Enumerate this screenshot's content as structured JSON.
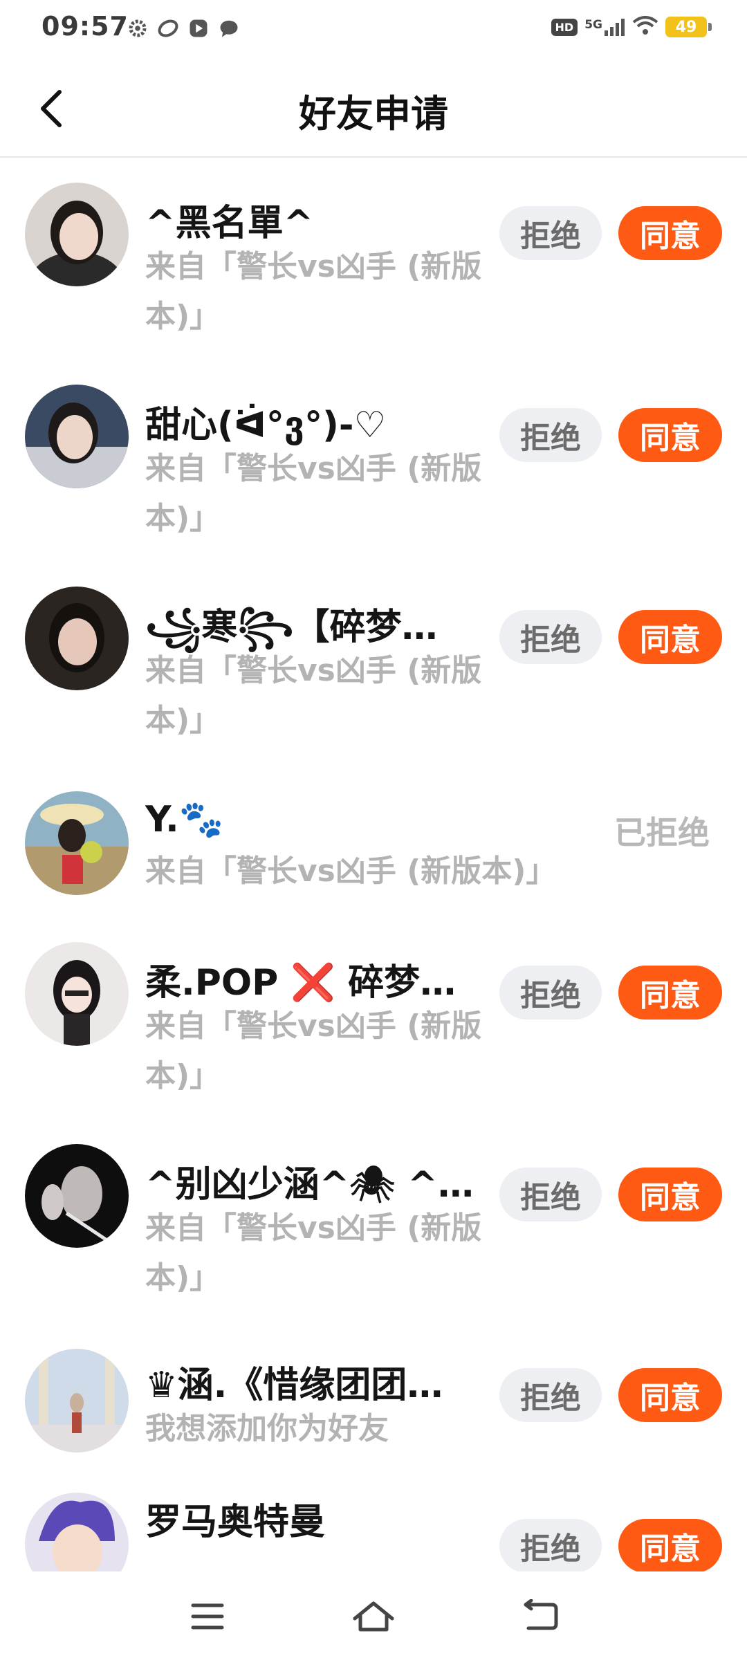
{
  "status_bar": {
    "time": "09:57",
    "hd": "HD",
    "network": "5G",
    "battery": "49"
  },
  "header": {
    "title": "好友申请"
  },
  "requests": [
    {
      "name": "^黑名單^",
      "source": "来自「警长vs凶手 (新版本)」",
      "reject": "拒绝",
      "accept": "同意"
    },
    {
      "name": "甜心(ᐛ°ვ°)-♡",
      "source": "来自「警长vs凶手 (新版本)」",
      "reject": "拒绝",
      "accept": "同意"
    },
    {
      "name": "꧁寒꧂【碎梦…",
      "source": "来自「警长vs凶手 (新版本)」",
      "reject": "拒绝",
      "accept": "同意"
    },
    {
      "name": "Y.🐾",
      "source": "来自「警长vs凶手 (新版本)」",
      "status": "已拒绝"
    },
    {
      "name": "柔.POP ❌ 碎梦…",
      "source": "来自「警长vs凶手 (新版本)」",
      "reject": "拒绝",
      "accept": "同意"
    },
    {
      "name": "^别凶少涵^🕷 ^…",
      "source": "来自「警长vs凶手 (新版本)」",
      "reject": "拒绝",
      "accept": "同意"
    },
    {
      "name": "♛涵.《惜缘团团…",
      "source": "我想添加你为好友",
      "reject": "拒绝",
      "accept": "同意"
    },
    {
      "name": "罗马奥特曼",
      "source": "",
      "reject": "拒绝",
      "accept": "同意"
    }
  ],
  "colors": {
    "accent": "#ff5a14",
    "reject_bg": "#eeeff3",
    "muted_text": "#b3b3b3"
  },
  "icons": {
    "back": "chevron-left-icon",
    "menu": "menu-icon",
    "home": "home-icon",
    "return": "back-nav-icon"
  }
}
